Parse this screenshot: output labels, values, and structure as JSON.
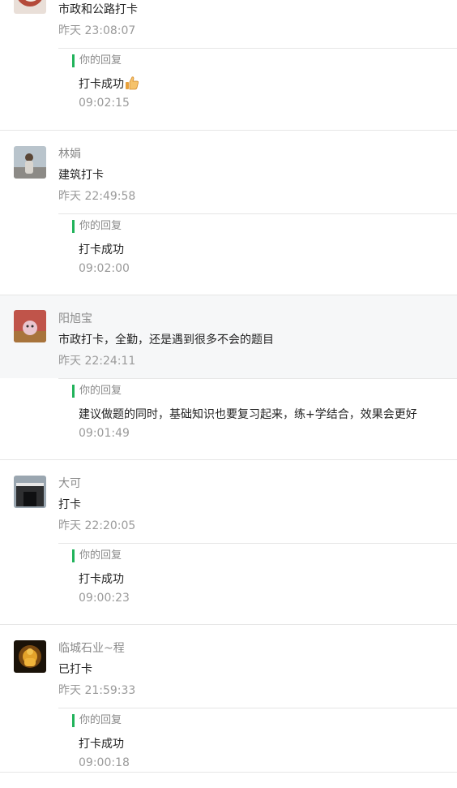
{
  "comments": [
    {
      "name": "",
      "content": "市政和公路打卡",
      "time": "昨天 23:08:07",
      "reply_label": "你的回复",
      "reply_content": "打卡成功",
      "reply_time": "09:02:15"
    },
    {
      "name": "林娟",
      "content": "建筑打卡",
      "time": "昨天 22:49:58",
      "reply_label": "你的回复",
      "reply_content": "打卡成功",
      "reply_time": "09:02:00"
    },
    {
      "name": "阳旭宝",
      "content": "市政打卡，全勤，还是遇到很多不会的题目",
      "time": "昨天 22:24:11",
      "reply_label": "你的回复",
      "reply_content": "建议做题的同时，基础知识也要复习起来，练+学结合，效果会更好",
      "reply_time": "09:01:49"
    },
    {
      "name": "大可",
      "content": "打卡",
      "time": "昨天 22:20:05",
      "reply_label": "你的回复",
      "reply_content": "打卡成功",
      "reply_time": "09:00:23"
    },
    {
      "name": "临城石业~程",
      "content": "已打卡",
      "time": "昨天 21:59:33",
      "reply_label": "你的回复",
      "reply_content": "打卡成功",
      "reply_time": "09:00:18"
    }
  ],
  "colors": {
    "reply_accent": "#21b35b",
    "highlight_bg": "#f6f7f8",
    "text": "#222222",
    "muted": "#9a9a9a"
  },
  "icons": {
    "reply_1_emoji": "thumbs-up-icon"
  }
}
